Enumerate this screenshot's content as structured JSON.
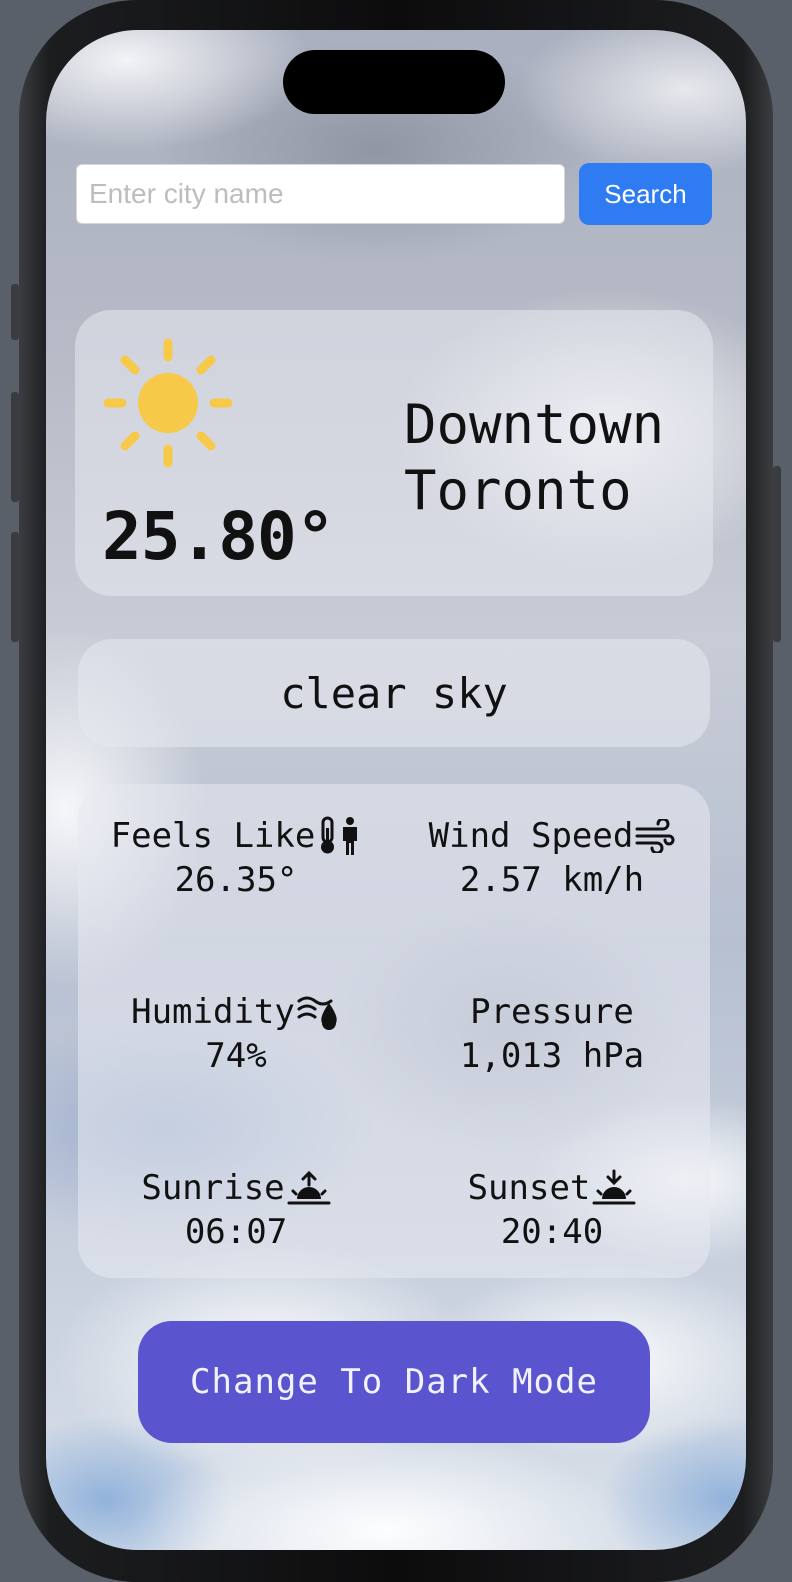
{
  "search": {
    "placeholder": "Enter city name",
    "value": "",
    "button_label": "Search"
  },
  "current": {
    "icon": "sun-icon",
    "temperature": "25.80°",
    "city_line1": "Downtown",
    "city_line2": "Toronto",
    "description": "clear sky"
  },
  "details": {
    "feels_like": {
      "label": "Feels Like",
      "value": "26.35°",
      "icon": "thermometer-person-icon"
    },
    "wind_speed": {
      "label": "Wind Speed",
      "value": "2.57 km/h",
      "icon": "wind-icon"
    },
    "humidity": {
      "label": "Humidity",
      "value": "74%",
      "icon": "humidity-icon"
    },
    "pressure": {
      "label": "Pressure",
      "value": "1,013 hPa"
    },
    "sunrise": {
      "label": "Sunrise",
      "value": "06:07",
      "icon": "sunrise-icon"
    },
    "sunset": {
      "label": "Sunset",
      "value": "20:40",
      "icon": "sunset-icon"
    }
  },
  "mode_button": {
    "label": "Change To Dark Mode"
  },
  "colors": {
    "search_button": "#2f7bf2",
    "sun": "#f7c948",
    "mode_button": "#5a55cf"
  }
}
